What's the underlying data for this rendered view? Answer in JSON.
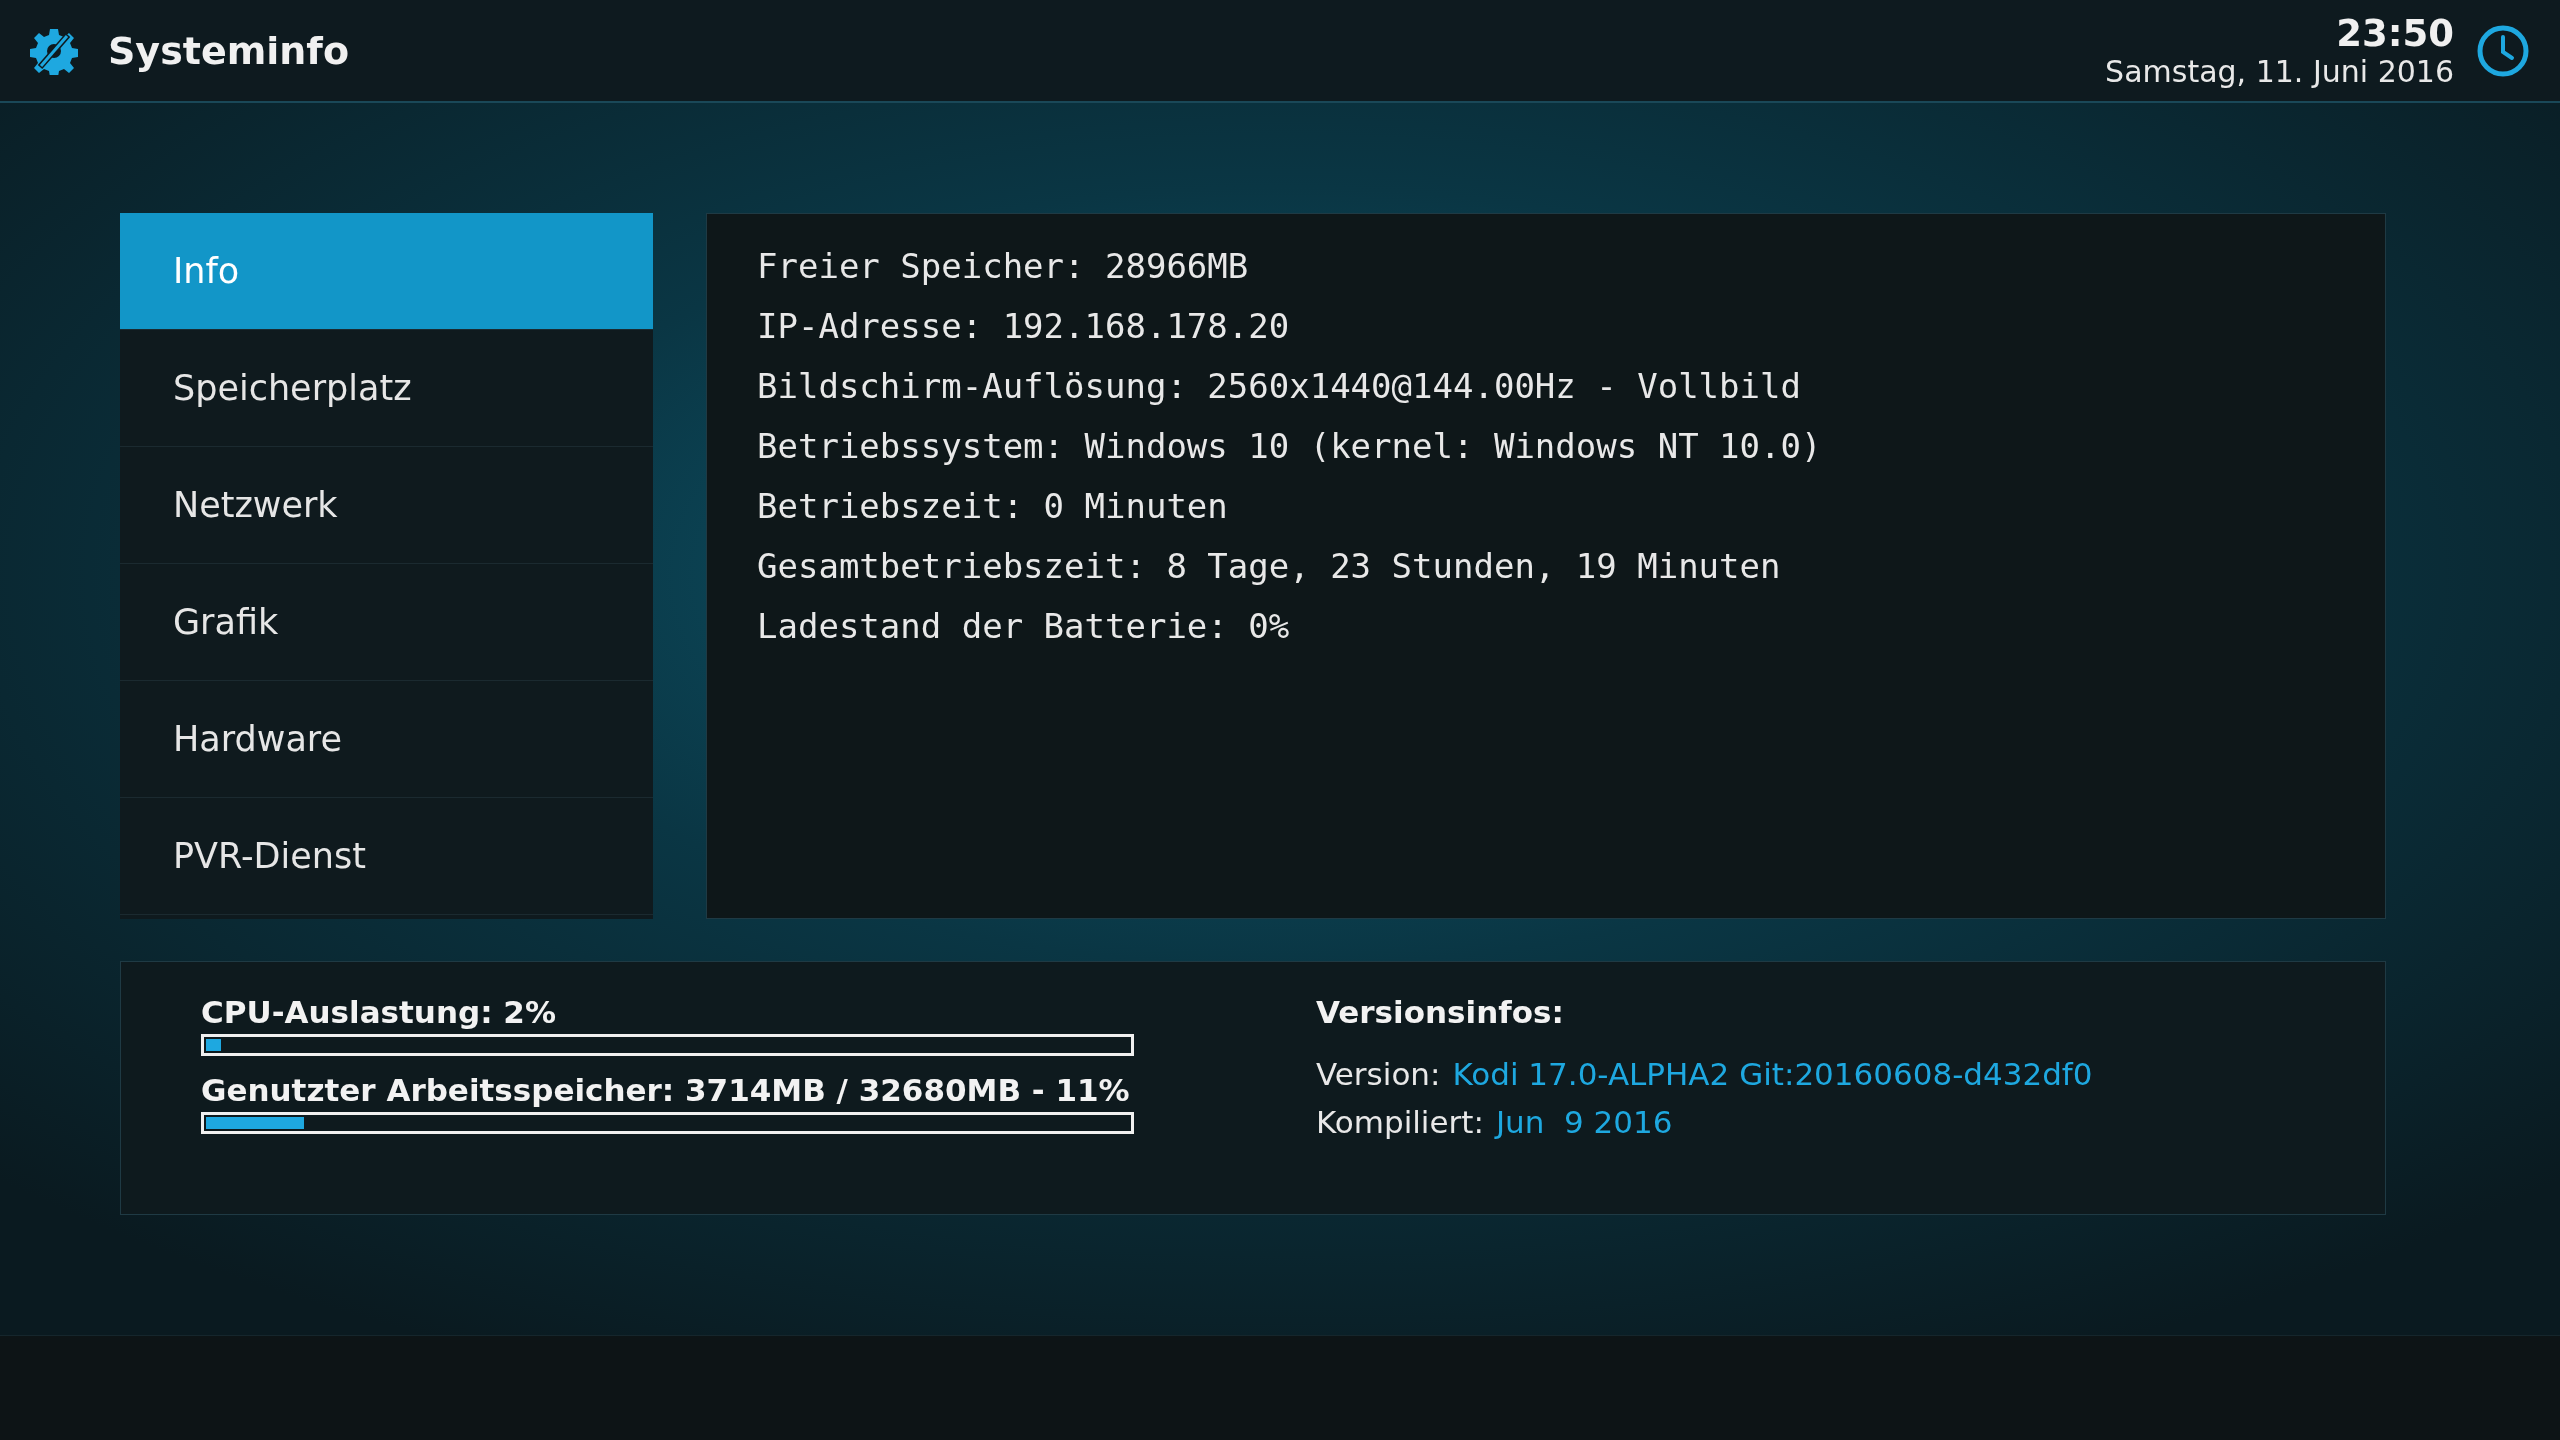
{
  "header": {
    "title": "Systeminfo",
    "time": "23:50",
    "date": "Samstag, 11. Juni 2016"
  },
  "menu": [
    {
      "label": "Info",
      "selected": true
    },
    {
      "label": "Speicherplatz",
      "selected": false
    },
    {
      "label": "Netzwerk",
      "selected": false
    },
    {
      "label": "Grafik",
      "selected": false
    },
    {
      "label": "Hardware",
      "selected": false
    },
    {
      "label": "PVR-Dienst",
      "selected": false
    }
  ],
  "info_lines": [
    "Freier Speicher: 28966MB",
    "IP-Adresse: 192.168.178.20",
    "Bildschirm-Auflösung: 2560x1440@144.00Hz - Vollbild",
    "Betriebssystem: Windows 10 (kernel: Windows NT 10.0)",
    "Betriebszeit: 0 Minuten",
    "Gesamtbetriebszeit: 8 Tage, 23 Stunden, 19 Minuten",
    "Ladestand der Batterie: 0%"
  ],
  "meters": [
    {
      "label": "CPU-Auslastung: 2%",
      "level": 0.02
    },
    {
      "label": "Genutzter Arbeitsspeicher: 3714MB / 32680MB - 11%",
      "level": 0.11
    }
  ],
  "version_info": {
    "heading": "Versionsinfos:",
    "rows": [
      {
        "label": "Version:",
        "value": "Kodi 17.0-ALPHA2 Git:20160608-d432df0"
      },
      {
        "label": "Kompiliert:",
        "value": "Jun  9 2016"
      }
    ]
  }
}
